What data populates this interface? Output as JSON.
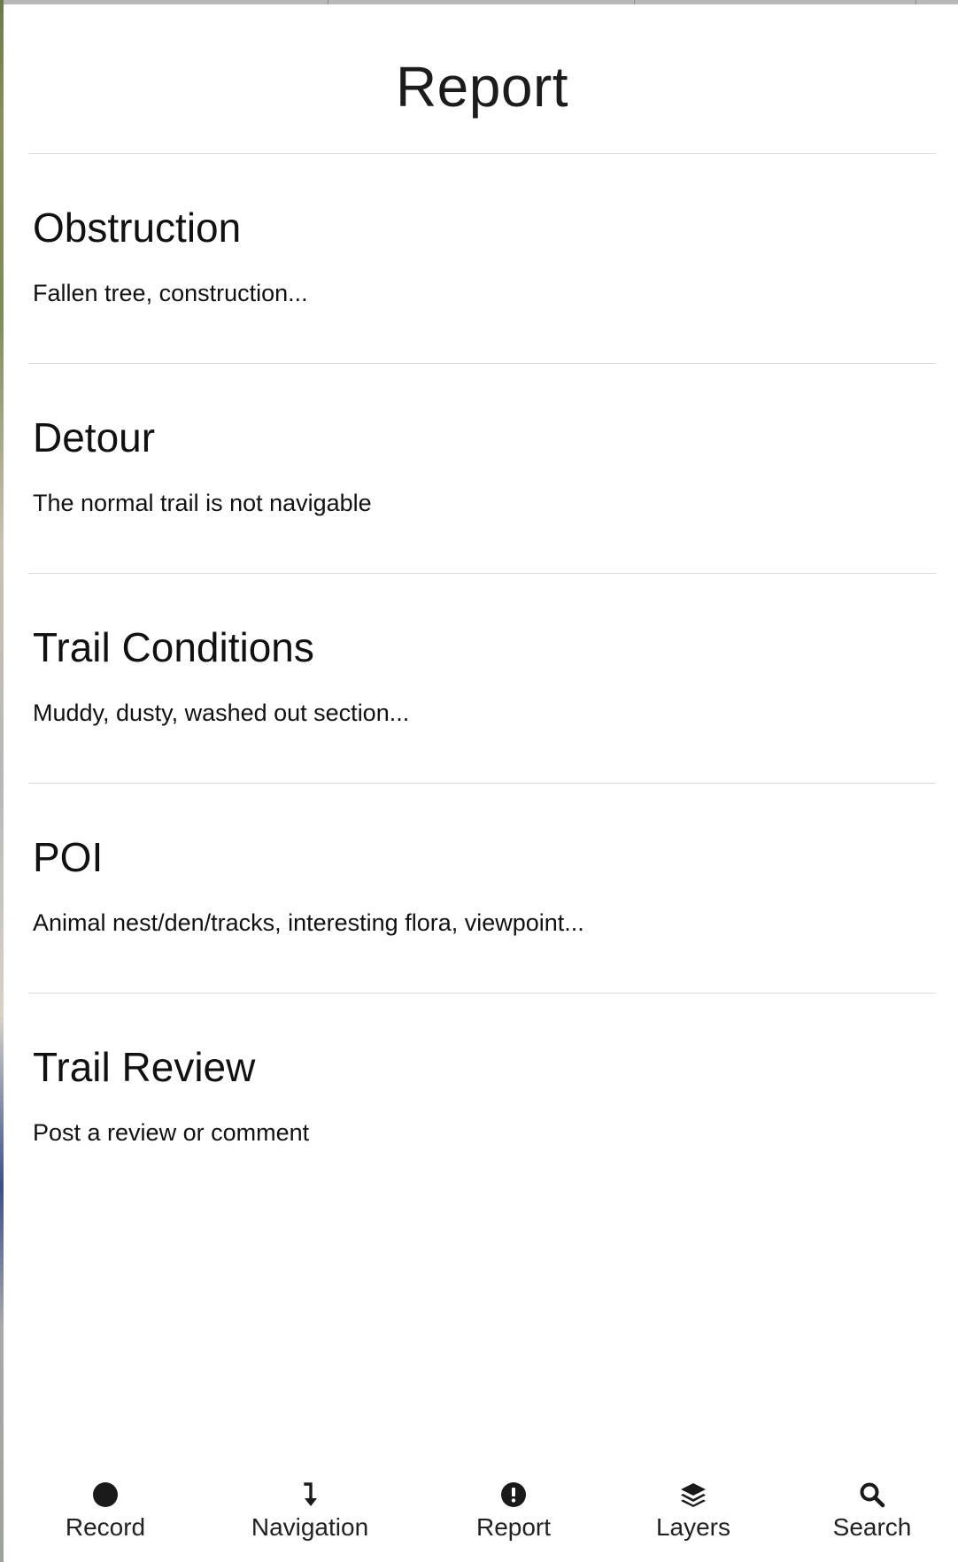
{
  "header": {
    "title": "Report"
  },
  "report_options": [
    {
      "title": "Obstruction",
      "description": "Fallen tree, construction..."
    },
    {
      "title": "Detour",
      "description": "The normal trail is not navigable"
    },
    {
      "title": "Trail Conditions",
      "description": "Muddy, dusty, washed out section..."
    },
    {
      "title": "POI",
      "description": "Animal nest/den/tracks, interesting flora, viewpoint..."
    },
    {
      "title": "Trail Review",
      "description": "Post a review or comment"
    }
  ],
  "tabbar": {
    "tabs": [
      {
        "label": "Record",
        "icon": "record-dot-icon"
      },
      {
        "label": "Navigation",
        "icon": "navigation-arrow-icon"
      },
      {
        "label": "Report",
        "icon": "alert-circle-icon"
      },
      {
        "label": "Layers",
        "icon": "layers-icon"
      },
      {
        "label": "Search",
        "icon": "search-icon"
      }
    ]
  },
  "colors": {
    "text": "#111111",
    "divider": "#dcdcdc",
    "background": "#ffffff",
    "icon": "#1a1a1a"
  }
}
